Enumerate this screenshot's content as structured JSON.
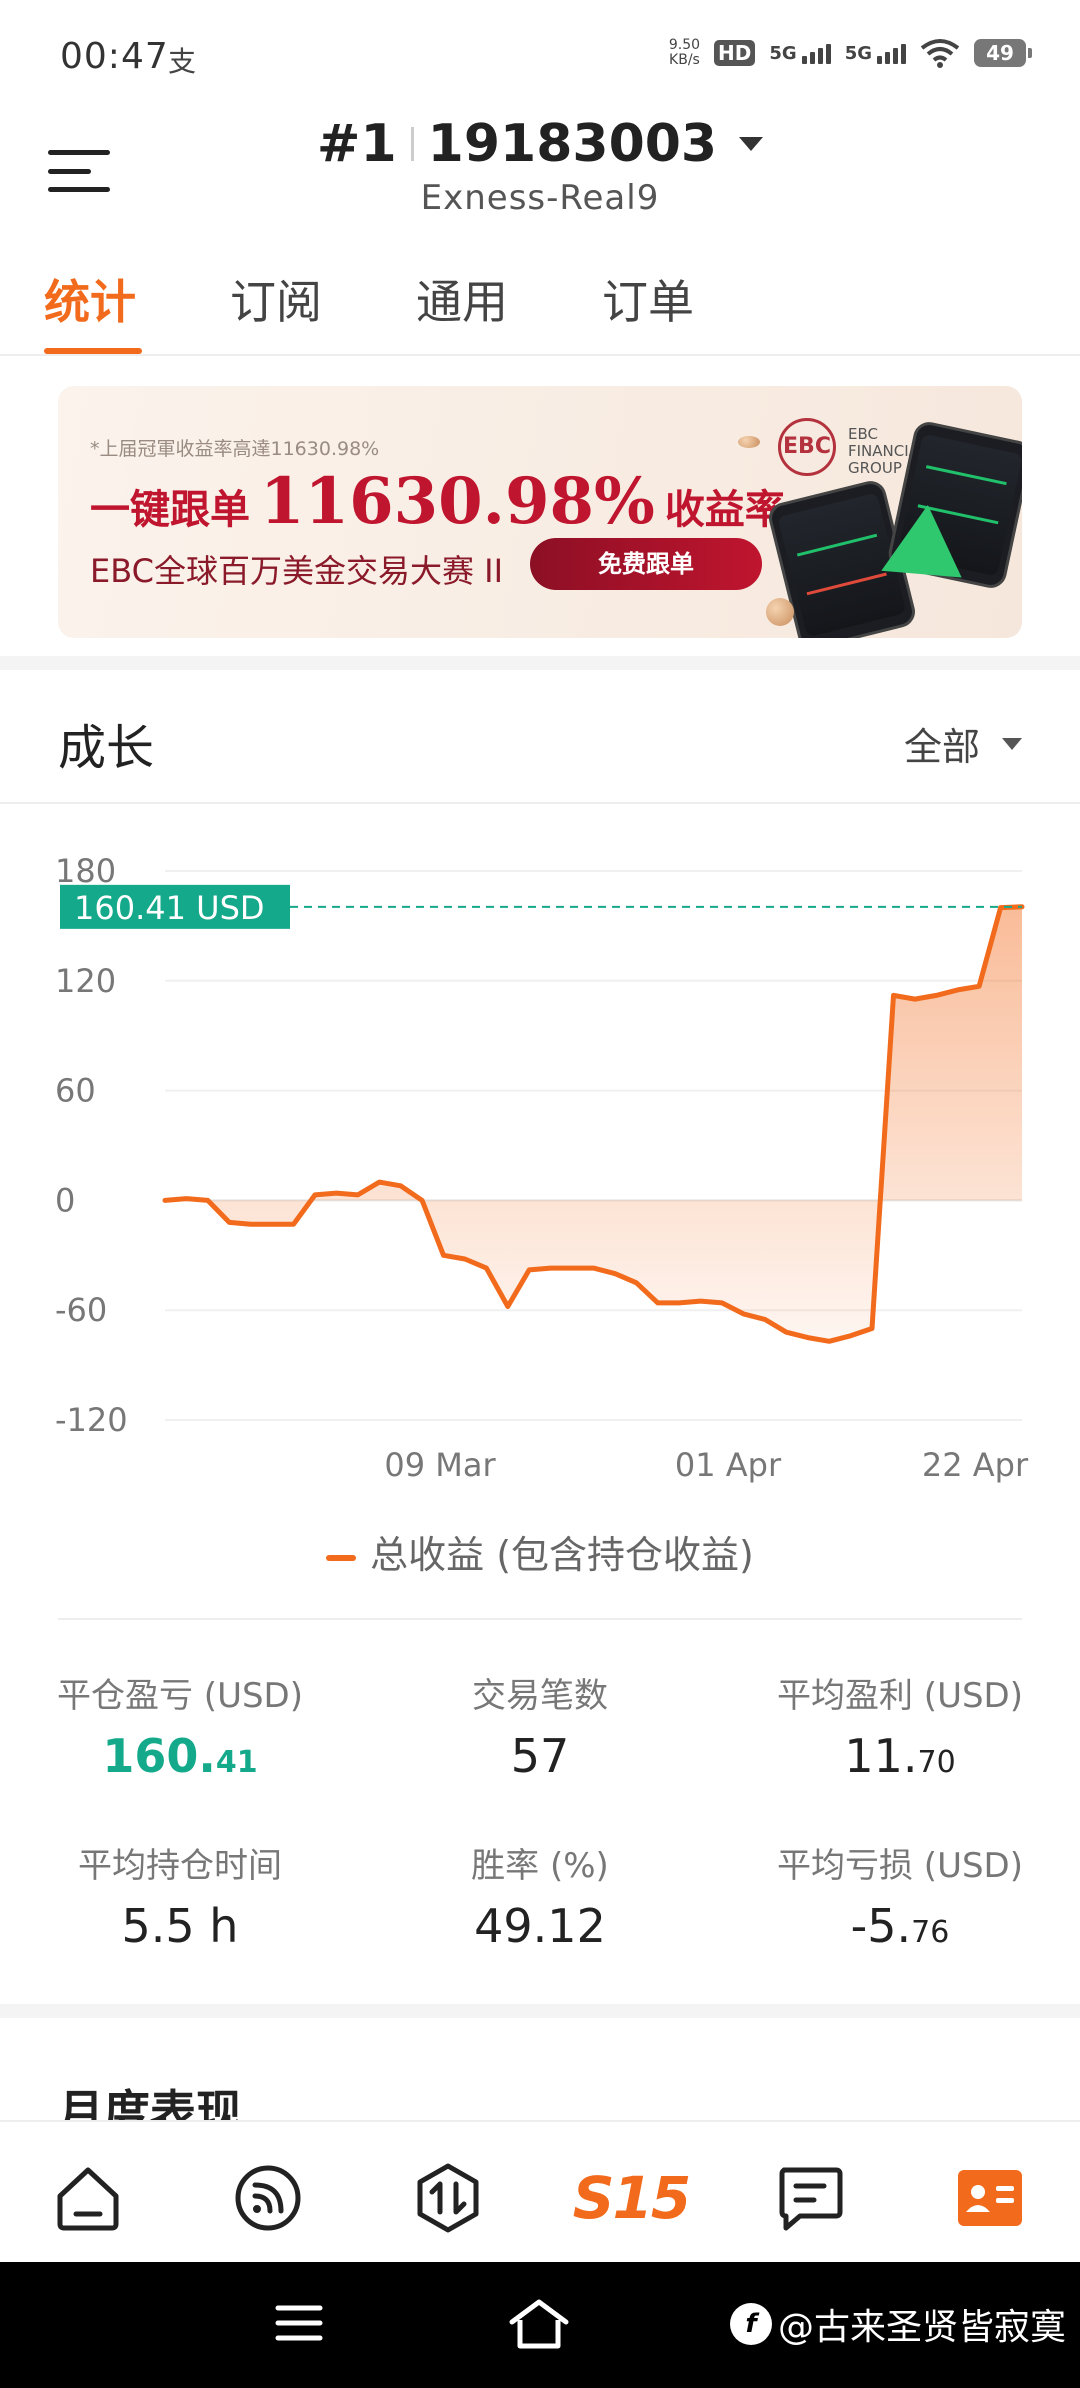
{
  "status": {
    "time": "00:47",
    "extra": "支",
    "net_speed": "9.50",
    "net_unit": "KB/s",
    "hd": "HD",
    "sim1": "5G",
    "sim2": "5G",
    "battery": "49"
  },
  "header": {
    "rank": "#1",
    "account": "19183003",
    "server": "Exness-Real9"
  },
  "tabs": [
    {
      "label": "统计",
      "active": true
    },
    {
      "label": "订阅",
      "active": false
    },
    {
      "label": "通用",
      "active": false
    },
    {
      "label": "订单",
      "active": false
    }
  ],
  "banner": {
    "note": "*上届冠軍收益率高達11630.98%",
    "lead": "一键跟单",
    "highlight": "11630.98%",
    "tail": "收益率",
    "subtitle": "EBC全球百万美金交易大赛 II",
    "button": "免费跟单",
    "logo": "EBC",
    "brand_lines": [
      "EBC",
      "FINANCIAL",
      "GROUP"
    ]
  },
  "growth": {
    "title": "成长",
    "filter": "全部"
  },
  "chart_data": {
    "type": "area",
    "y_ticks": [
      "180",
      "120",
      "60",
      "0",
      "-60",
      "-120"
    ],
    "ylim": [
      -120,
      180
    ],
    "x_ticks": [
      "09 Mar",
      "01 Apr",
      "22 Apr"
    ],
    "current_value_label": "160.41 USD",
    "current_value": 160.41,
    "series": [
      {
        "name": "总收益 (包含持仓收益)",
        "color": "#f26a1b",
        "values": [
          0,
          1,
          0,
          -12,
          -13,
          -13,
          -13,
          3,
          4,
          3,
          10,
          8,
          0,
          -30,
          -32,
          -37,
          -58,
          -38,
          -37,
          -37,
          -37,
          -40,
          -45,
          -56,
          -56,
          -55,
          -56,
          -62,
          -65,
          -72,
          -75,
          -77,
          -74,
          -70,
          112,
          110,
          112,
          115,
          117,
          160,
          160.41
        ]
      }
    ]
  },
  "legend": {
    "label": "总收益 (包含持仓收益)"
  },
  "stats": [
    {
      "label": "平仓盈亏 (USD)",
      "int": "160.",
      "dec": "41",
      "green": true
    },
    {
      "label": "交易笔数",
      "int": "57",
      "dec": "",
      "green": false
    },
    {
      "label": "平均盈利 (USD)",
      "int": "11.",
      "dec": "70",
      "green": false
    },
    {
      "label": "平均持仓时间",
      "int": "5.5 h",
      "dec": "",
      "green": false
    },
    {
      "label": "胜率 (%)",
      "int": "49.12",
      "dec": "",
      "green": false
    },
    {
      "label": "平均亏损 (USD)",
      "int": "-5.",
      "dec": "76",
      "green": false
    }
  ],
  "monthly_title": "月度表现",
  "bottom_nav": {
    "items": [
      "home-icon",
      "feed-icon",
      "trade-icon",
      "s15-icon",
      "message-icon",
      "profile-icon"
    ],
    "s15_label": "S15",
    "accent": "#f26a1b"
  },
  "watermark": "@古来圣贤皆寂寞"
}
